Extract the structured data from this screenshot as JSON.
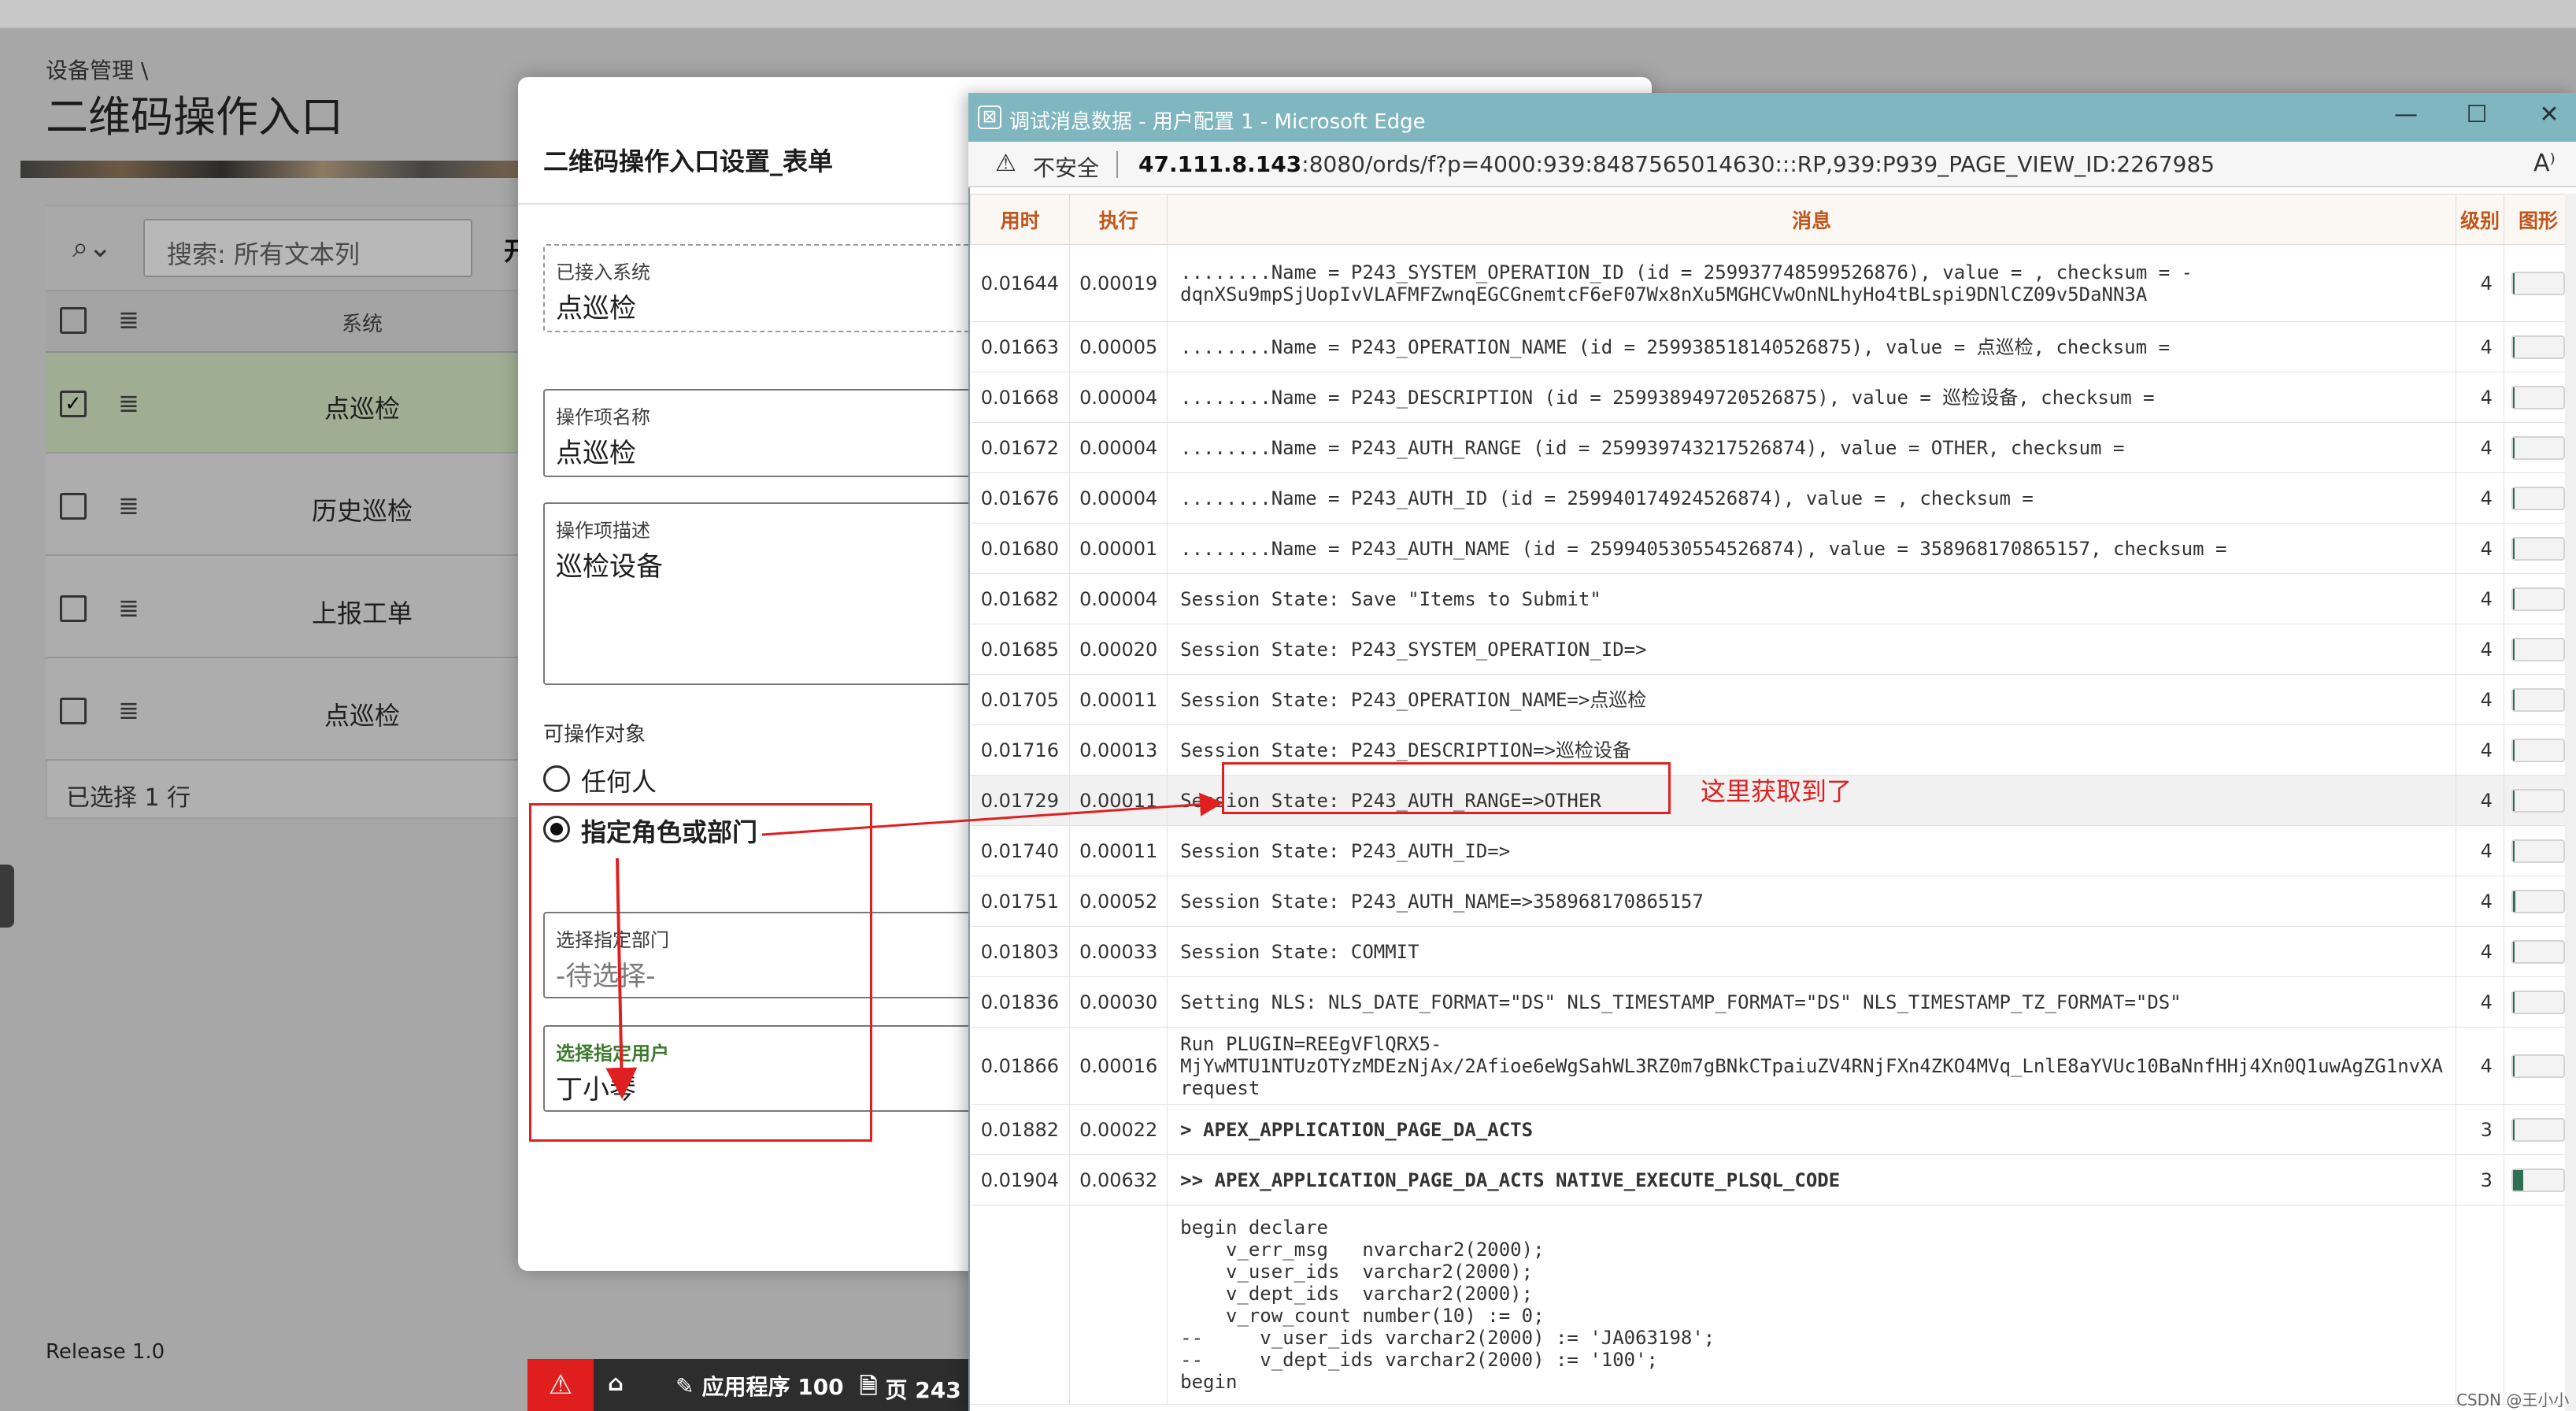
{
  "background_page": {
    "breadcrumb": "设备管理 \\",
    "title": "二维码操作入口",
    "search_placeholder": "搜索: 所有文本列",
    "search_overflow_char": "开",
    "grid_header_system": "系统",
    "rows": [
      "点巡检",
      "历史巡检",
      "上报工单",
      "点巡检"
    ],
    "selected_count": "已选择 1 行",
    "release": "Release 1.0"
  },
  "modal": {
    "title": "二维码操作入口设置_表单",
    "connected_system_label": "已接入系统",
    "connected_system_value": "点巡检",
    "op_name_label": "操作项名称",
    "op_name_value": "点巡检",
    "op_desc_label": "操作项描述",
    "op_desc_value": "巡检设备",
    "target_label": "可操作对象",
    "radio_anyone": "任何人",
    "radio_role_dept": "指定角色或部门",
    "dept_label": "选择指定部门",
    "dept_placeholder": "-待选择-",
    "user_label": "选择指定用户",
    "user_value": "丁小琴"
  },
  "dev_toolbar": {
    "app": "应用程序 100",
    "page": "页 243"
  },
  "edge": {
    "title": "调试消息数据 - 用户配置 1 - Microsoft Edge",
    "insecure": "不安全",
    "url_host": "47.111.8.143",
    "url_rest": ":8080/ords/f?p=4000:939:8487565014630:::RP,939:P939_PAGE_VIEW_ID:2267985",
    "ctrl_min": "—",
    "ctrl_max": "☐",
    "ctrl_close": "✕",
    "reader_icon": "Aͅ",
    "headers": {
      "elapsed": "用时",
      "exec": "执行",
      "message": "消息",
      "level": "级别",
      "graph": "图形"
    },
    "rows": [
      {
        "t": "0.01644",
        "e": "0.00019",
        "m": "........Name = P243_SYSTEM_OPERATION_ID (id = 259937748599526876), value = , checksum = -dqnXSu9mpSjUopIvVLAFMFZwnqEGCGnemtcF6eF07Wx8nXu5MGHCVwOnNLhyHo4tBLspi9DNlCZ09v5DaNN3A",
        "l": "4",
        "g": 0.03
      },
      {
        "t": "0.01663",
        "e": "0.00005",
        "m": "........Name = P243_OPERATION_NAME (id = 259938518140526875), value = 点巡检, checksum =",
        "l": "4",
        "g": 0
      },
      {
        "t": "0.01668",
        "e": "0.00004",
        "m": "........Name = P243_DESCRIPTION (id = 259938949720526875), value = 巡检设备, checksum =",
        "l": "4",
        "g": 0
      },
      {
        "t": "0.01672",
        "e": "0.00004",
        "m": "........Name = P243_AUTH_RANGE (id = 259939743217526874), value = OTHER, checksum =",
        "l": "4",
        "g": 0
      },
      {
        "t": "0.01676",
        "e": "0.00004",
        "m": "........Name = P243_AUTH_ID (id = 259940174924526874), value = , checksum =",
        "l": "4",
        "g": 0
      },
      {
        "t": "0.01680",
        "e": "0.00001",
        "m": "........Name = P243_AUTH_NAME (id = 259940530554526874), value = 358968170865157, checksum =",
        "l": "4",
        "g": 0
      },
      {
        "t": "0.01682",
        "e": "0.00004",
        "m": "Session State: Save \"Items to Submit\"",
        "l": "4",
        "g": 0
      },
      {
        "t": "0.01685",
        "e": "0.00020",
        "m": "Session State: P243_SYSTEM_OPERATION_ID=>",
        "l": "4",
        "g": 0.03
      },
      {
        "t": "0.01705",
        "e": "0.00011",
        "m": "Session State: P243_OPERATION_NAME=>点巡检",
        "l": "4",
        "g": 0
      },
      {
        "t": "0.01716",
        "e": "0.00013",
        "m": "Session State: P243_DESCRIPTION=>巡检设备",
        "l": "4",
        "g": 0
      },
      {
        "t": "0.01729",
        "e": "0.00011",
        "m": "Session State: P243_AUTH_RANGE=>OTHER",
        "l": "4",
        "g": 0
      },
      {
        "t": "0.01740",
        "e": "0.00011",
        "m": "Session State: P243_AUTH_ID=>",
        "l": "4",
        "g": 0
      },
      {
        "t": "0.01751",
        "e": "0.00052",
        "m": "Session State: P243_AUTH_NAME=>358968170865157",
        "l": "4",
        "g": 0.05
      },
      {
        "t": "0.01803",
        "e": "0.00033",
        "m": "Session State: COMMIT",
        "l": "4",
        "g": 0.03
      },
      {
        "t": "0.01836",
        "e": "0.00030",
        "m": "Setting NLS: NLS_DATE_FORMAT=\"DS\" NLS_TIMESTAMP_FORMAT=\"DS\" NLS_TIMESTAMP_TZ_FORMAT=\"DS\"",
        "l": "4",
        "g": 0.03
      },
      {
        "t": "0.01866",
        "e": "0.00016",
        "m": "Run PLUGIN=REEgVFlQRX5-MjYwMTU1NTUzOTYzMDEzNjAx/2Afioe6eWgSahWL3RZ0m7gBNkCTpaiuZV4RNjFXn4ZKO4MVq_LnlE8aYVUc10BaNnfHHj4Xn0Q1uwAgZG1nvXA request",
        "l": "4",
        "g": 0.03
      },
      {
        "t": "0.01882",
        "e": "0.00022",
        "m": "> APEX_APPLICATION_PAGE_DA_ACTS",
        "l": "3",
        "g": 0.03,
        "bold": true
      },
      {
        "t": "0.01904",
        "e": "0.00632",
        "m": ">> APEX_APPLICATION_PAGE_DA_ACTS NATIVE_EXECUTE_PLSQL_CODE",
        "l": "3",
        "g": 0.2,
        "bold": true
      }
    ],
    "code": "begin declare\n    v_err_msg   nvarchar2(2000);\n    v_user_ids  varchar2(2000);\n    v_dept_ids  varchar2(2000);\n    v_row_count number(10) := 0;\n--     v_user_ids varchar2(2000) := 'JA063198';\n--     v_dept_ids varchar2(2000) := '100';\nbegin"
  },
  "annotation": "这里获取到了",
  "watermark": "CSDN @王小小鸭",
  "colors": {
    "annotation_red": "#e02020",
    "edge_titlebar": "#7fb6bf",
    "header_orange": "#c0561b"
  }
}
